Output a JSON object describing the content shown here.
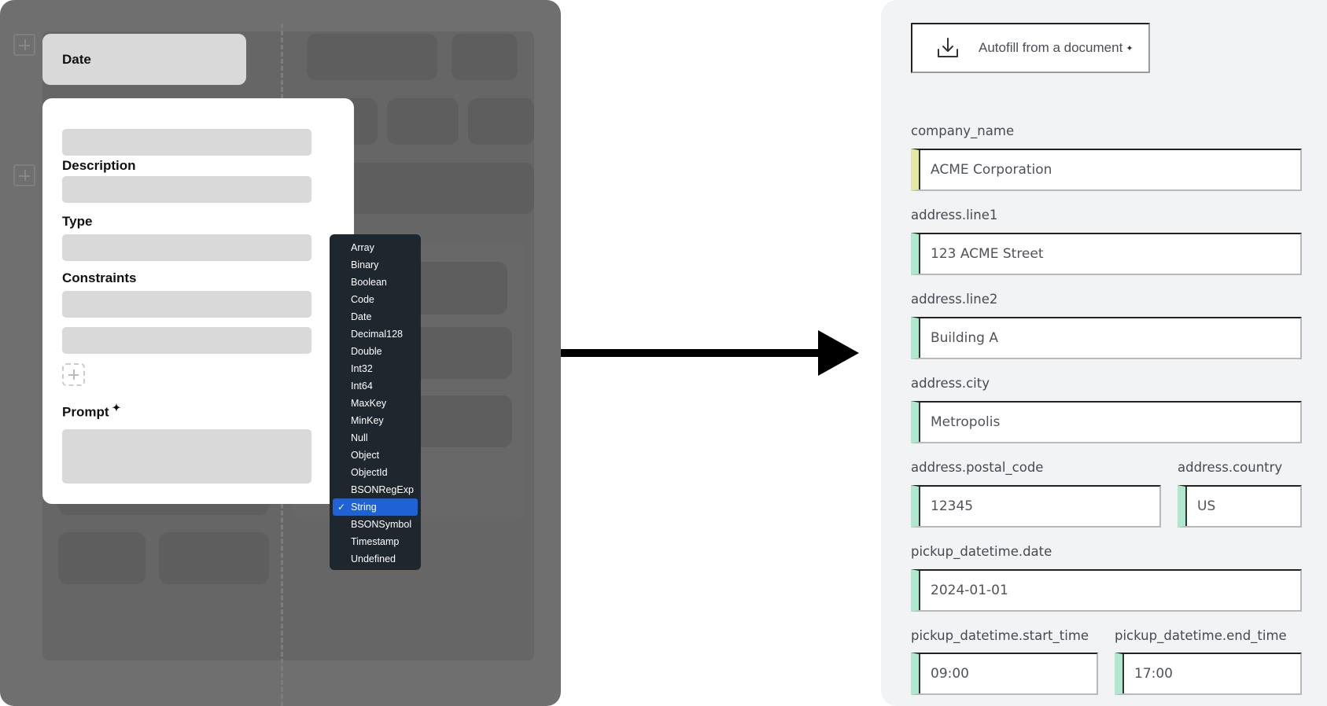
{
  "left": {
    "date_tab": "Date",
    "labels": {
      "description": "Description",
      "type": "Type",
      "constraints": "Constraints",
      "prompt": "Prompt"
    },
    "type_options": [
      "Array",
      "Binary",
      "Boolean",
      "Code",
      "Date",
      "Decimal128",
      "Double",
      "Int32",
      "Int64",
      "MaxKey",
      "MinKey",
      "Null",
      "Object",
      "ObjectId",
      "BSONRegExp",
      "String",
      "BSONSymbol",
      "Timestamp",
      "Undefined"
    ],
    "selected_type": "String"
  },
  "right": {
    "autofill_label": "Autofill from a document",
    "fields": [
      {
        "label": "company_name",
        "value": "ACME Corporation",
        "status": "yellow"
      },
      {
        "label": "address.line1",
        "value": "123 ACME Street",
        "status": "green"
      },
      {
        "label": "address.line2",
        "value": "Building A",
        "status": "green"
      },
      {
        "label": "address.city",
        "value": "Metropolis",
        "status": "green"
      },
      {
        "label": "address.postal_code",
        "value": "12345",
        "status": "green"
      },
      {
        "label": "address.country",
        "value": "US",
        "status": "green"
      },
      {
        "label": "pickup_datetime.date",
        "value": "2024-01-01",
        "status": "green"
      },
      {
        "label": "pickup_datetime.start_time",
        "value": "09:00",
        "status": "green"
      },
      {
        "label": "pickup_datetime.end_time",
        "value": "17:00",
        "status": "green"
      }
    ]
  },
  "colors": {
    "status_green": "#aee8cf",
    "status_yellow": "#e4e7a4",
    "menu_selected": "#1f62d6",
    "menu_bg": "#1f272e"
  },
  "icons": {
    "autofill": "download-icon",
    "prompt": "sparkle-icon"
  }
}
